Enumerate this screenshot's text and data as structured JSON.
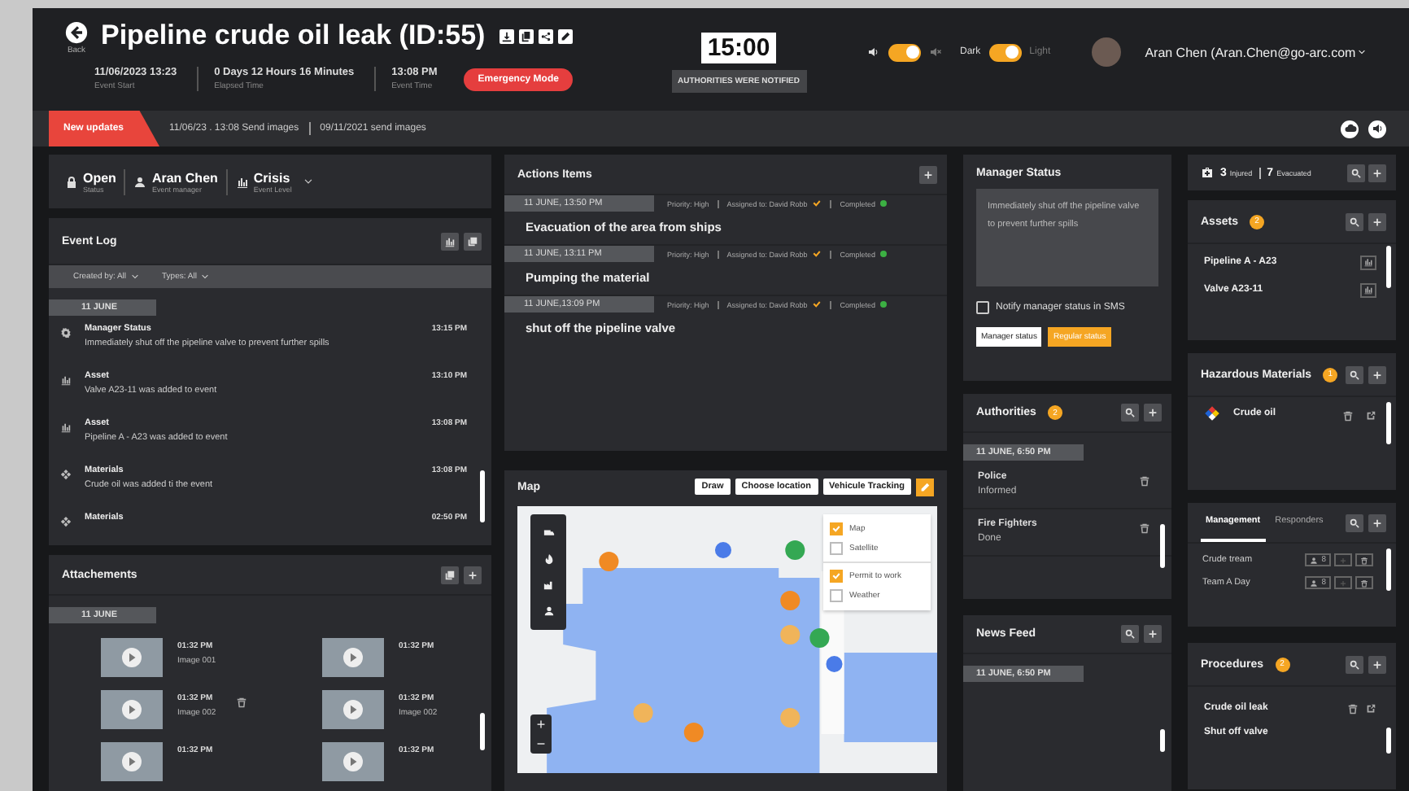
{
  "header": {
    "back_label": "Back",
    "title": "Pipeline crude oil leak (ID:55)",
    "clock": "15:00",
    "authorities_button": "AUTHORITIES WERE NOTIFIED",
    "sound_toggle": {
      "on": true
    },
    "theme_toggle": {
      "left_label": "Dark",
      "right_label": "Light",
      "on": true
    },
    "user": "Aran Chen (Aran.Chen@go-arc.com",
    "stats": [
      {
        "value": "11/06/2023 13:23",
        "label": "Event Start"
      },
      {
        "value": "0 Days 12 Hours 16 Minutes",
        "label": "Elapsed Time"
      },
      {
        "value": "13:08 PM",
        "label": "Event Time"
      }
    ],
    "emergency_button": "Emergency Mode"
  },
  "updates": {
    "tag": "New updates",
    "items": [
      "11/06/23 . 13:08 Send images",
      "09/11/2021 send images"
    ]
  },
  "status_card": [
    {
      "kind": "lock",
      "value": "Open",
      "label": "Status"
    },
    {
      "kind": "person",
      "value": "Aran Chen",
      "label": "Event manager"
    },
    {
      "kind": "level",
      "value": "Crisis",
      "label": "Event Level"
    }
  ],
  "event_log": {
    "title": "Event Log",
    "filters": [
      "Created by: All",
      "Types: All"
    ],
    "date": "11 JUNE",
    "entries": [
      {
        "kind": "manager_status",
        "title": "Manager Status",
        "text": "Immediately shut off the pipeline valve to prevent further spills",
        "time": "13:15 PM"
      },
      {
        "kind": "asset",
        "title": "Asset",
        "text": "Valve A23-11 was added to event",
        "time": "13:10 PM"
      },
      {
        "kind": "asset",
        "title": "Asset",
        "text": "Pipeline A - A23  was added to event",
        "time": "13:08 PM"
      },
      {
        "kind": "material",
        "title": "Materials",
        "text": "Crude oil was added ti the event",
        "time": "13:08 PM"
      },
      {
        "kind": "material",
        "title": "Materials",
        "time": "02:50 PM"
      }
    ]
  },
  "attachments": {
    "title": "Attachements",
    "date": "11 JUNE",
    "items": [
      {
        "time": "01:32 PM",
        "name": "Image 001",
        "deletable": false
      },
      {
        "time": "01:32 PM",
        "deletable": false
      },
      {
        "time": "01:32 PM",
        "name": "Image 002",
        "deletable": true
      },
      {
        "time": "01:32 PM",
        "name": "Image 002",
        "deletable": false
      },
      {
        "time": "01:32 PM",
        "deletable": false
      },
      {
        "time": "01:32 PM",
        "deletable": false
      }
    ]
  },
  "actions": {
    "title": "Actions Items",
    "items": [
      {
        "date": "11 JUNE, 13:50 PM",
        "priority": "Priority: High",
        "assignee": "Assigned to: David Robb",
        "status": "Completed",
        "title": "Evacuation of the area from ships"
      },
      {
        "date": "11 JUNE, 13:11 PM",
        "priority": "Priority: High",
        "assignee": "Assigned to: David Robb",
        "status": "Completed",
        "title": "Pumping the material"
      },
      {
        "date": "11 JUNE,13:09 PM",
        "priority": "Priority: High",
        "assignee": "Assigned to: David Robb",
        "status": "Completed",
        "title": "shut off the pipeline valve"
      }
    ]
  },
  "map": {
    "title": "Map",
    "buttons": [
      "Draw",
      "Choose location",
      "Vehicule Tracking"
    ],
    "layers": [
      {
        "label": "Map",
        "checked": true
      },
      {
        "label": "Satellite",
        "checked": false
      },
      {
        "label": "Permit to work",
        "checked": true
      },
      {
        "label": "Weather",
        "checked": false
      }
    ],
    "zoom": [
      "+",
      "−"
    ]
  },
  "manager_status": {
    "title": "Manager Status",
    "message": "Immediately shut off the pipeline valve to prevent further spills",
    "notify": {
      "label": "Notify manager status in SMS",
      "checked": false
    },
    "buttons": [
      {
        "label": "Manager status",
        "selected": true
      },
      {
        "label": "Regular status",
        "selected": false
      }
    ]
  },
  "authorities": {
    "title": "Authorities",
    "count": "2",
    "date": "11 JUNE, 6:50 PM",
    "items": [
      {
        "name": "Police",
        "status": "Informed"
      },
      {
        "name": "Fire Fighters",
        "status": "Done"
      }
    ]
  },
  "news_feed": {
    "title": "News Feed",
    "date": "11 JUNE, 6:50 PM"
  },
  "casualties": {
    "injured": "3",
    "injured_label": "Injured",
    "evacuated": "7",
    "evacuated_label": "Evacuated"
  },
  "assets": {
    "title": "Assets",
    "count": "2",
    "items": [
      "Pipeline A - A23",
      "Valve A23-11"
    ]
  },
  "hazardous": {
    "title": "Hazardous Materials",
    "count": "1",
    "items": [
      "Crude oil"
    ]
  },
  "teams": {
    "tabs": [
      {
        "label": "Management",
        "selected": true
      },
      {
        "label": "Responders",
        "selected": false
      }
    ],
    "items": [
      {
        "name": "Crude tream",
        "members": "8"
      },
      {
        "name": "Team A Day",
        "members": "8"
      }
    ]
  },
  "procedures": {
    "title": "Procedures",
    "count": "2",
    "items": [
      "Crude oil leak",
      "Shut off valve"
    ]
  }
}
